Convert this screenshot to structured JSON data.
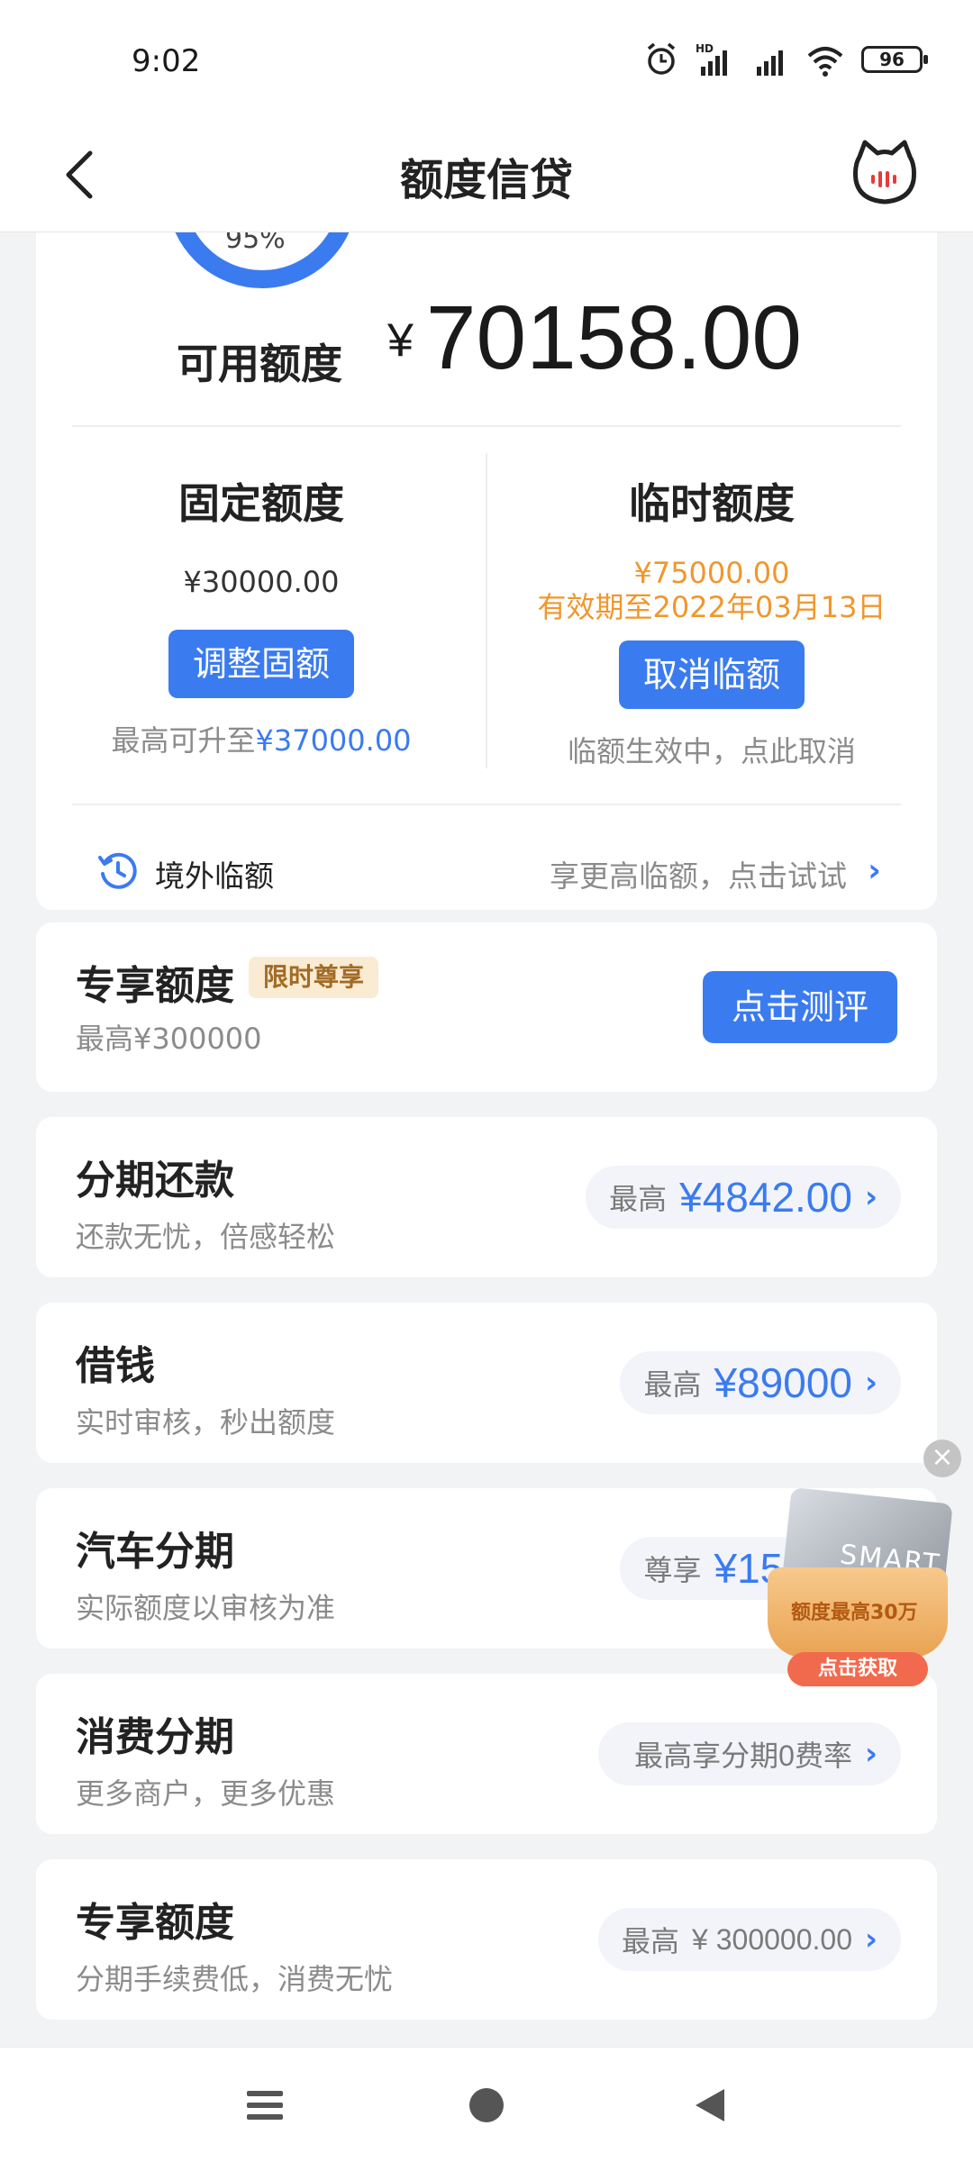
{
  "status_bar": {
    "time": "9:02",
    "battery": "96"
  },
  "nav": {
    "title": "额度信贷"
  },
  "summary": {
    "ring_percent": "95%",
    "available_label": "可用额度",
    "currency": "¥",
    "available_amount": "70158.00"
  },
  "fixed_limit": {
    "title": "固定额度",
    "amount": "¥30000.00",
    "button": "调整固额",
    "note_prefix": "最高可升至",
    "note_value": "¥37000.00"
  },
  "temp_limit": {
    "title": "临时额度",
    "amount": "¥75000.00",
    "validity": "有效期至2022年03月13日",
    "button": "取消临额",
    "note": "临额生效中，点此取消"
  },
  "overseas": {
    "label": "境外临额",
    "hint": "享更高临额，点击试试"
  },
  "exclusive": {
    "title": "专享额度",
    "tag": "限时尊享",
    "subtitle": "最高¥300000",
    "button": "点击测评"
  },
  "products": [
    {
      "title": "分期还款",
      "subtitle": "还款无忧，倍感轻松",
      "pill_label": "最高",
      "pill_value": "¥4842.00"
    },
    {
      "title": "借钱",
      "subtitle": "实时审核，秒出额度",
      "pill_label": "最高",
      "pill_value": "¥89000"
    },
    {
      "title": "汽车分期",
      "subtitle": "实际额度以审核为准",
      "pill_label": "尊享",
      "pill_value": "¥15400"
    },
    {
      "title": "消费分期",
      "subtitle": "更多商户，更多优惠",
      "pill_label": "",
      "pill_value": "最高享分期0费率"
    },
    {
      "title": "专享额度",
      "subtitle": "分期手续费低，消费无忧",
      "pill_label": "最高",
      "pill_value": "¥ 300000.00"
    }
  ],
  "float_ad": {
    "card_text": "SMART",
    "headline": "额度最高30万",
    "button": "点击获取"
  }
}
